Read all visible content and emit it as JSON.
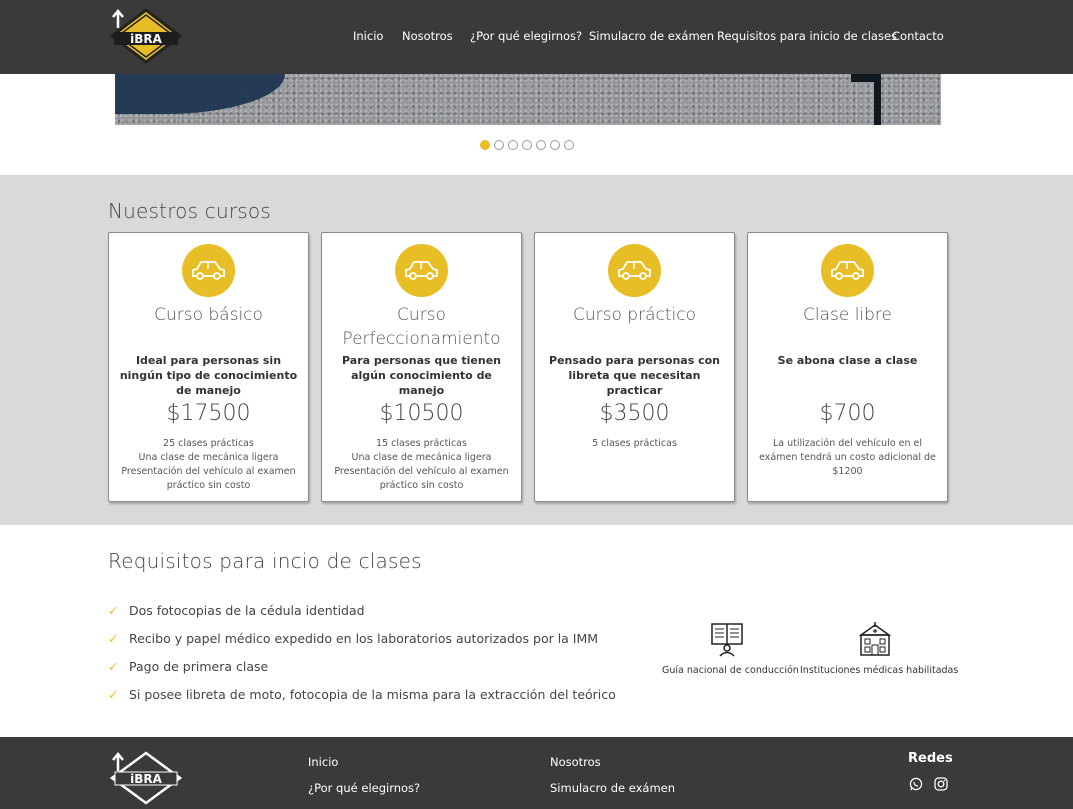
{
  "brand": {
    "logo_text": "iBRA"
  },
  "nav": {
    "items": [
      "Inicio",
      "Nosotros",
      "¿Por qué elegirnos?",
      "Simulacro de exámen",
      "Requisitos para inicio de clases",
      "Contacto"
    ]
  },
  "carousel": {
    "slide_count": 7,
    "active_index": 0
  },
  "courses": {
    "title": "Nuestros cursos",
    "cards": [
      {
        "name": "Curso básico",
        "desc": "Ideal para personas sin ningún tipo de conocimiento de manejo",
        "price": "$17500",
        "details": [
          "25 clases prácticas",
          "Una clase de mecánica ligera",
          "Presentación del vehículo al examen práctico sin costo"
        ]
      },
      {
        "name": "Curso Perfeccionamiento",
        "desc": "Para personas que tienen algún conocimiento de manejo",
        "price": "$10500",
        "details": [
          "15 clases prácticas",
          "Una clase de mecánica ligera",
          "Presentación del vehículo al examen práctico sin costo"
        ]
      },
      {
        "name": "Curso práctico",
        "desc": "Pensado para personas con libreta que necesitan practicar",
        "price": "$3500",
        "details": [
          "5 clases prácticas"
        ]
      },
      {
        "name": "Clase libre",
        "desc": "Se abona clase a clase",
        "price": "$700",
        "details": [
          "La utilización del vehículo en el exámen tendrá un costo adicional de $1200"
        ]
      }
    ]
  },
  "requirements": {
    "title": "Requisitos para incio de clases",
    "items": [
      "Dos fotocopias de la cédula identidad",
      "Recibo y papel médico expedido en los laboratorios autorizados por la IMM",
      "Pago de primera clase",
      "Si posee libreta de moto, fotocopia de la misma para la extracción del teórico"
    ],
    "resources": [
      {
        "label": "Guía nacional de conducción",
        "icon": "book-reader-icon"
      },
      {
        "label": "Instituciones médicas habilitadas",
        "icon": "hospital-icon"
      }
    ]
  },
  "footer": {
    "links_col1": [
      "Inicio",
      "¿Por qué elegirnos?"
    ],
    "links_col2": [
      "Nosotros",
      "Simulacro de exámen"
    ],
    "social_title": "Redes",
    "social": [
      "whatsapp-icon",
      "instagram-icon"
    ]
  },
  "colors": {
    "accent": "#e8be26",
    "header": "#3a3a3a",
    "section_bg": "#d9d9d9"
  }
}
